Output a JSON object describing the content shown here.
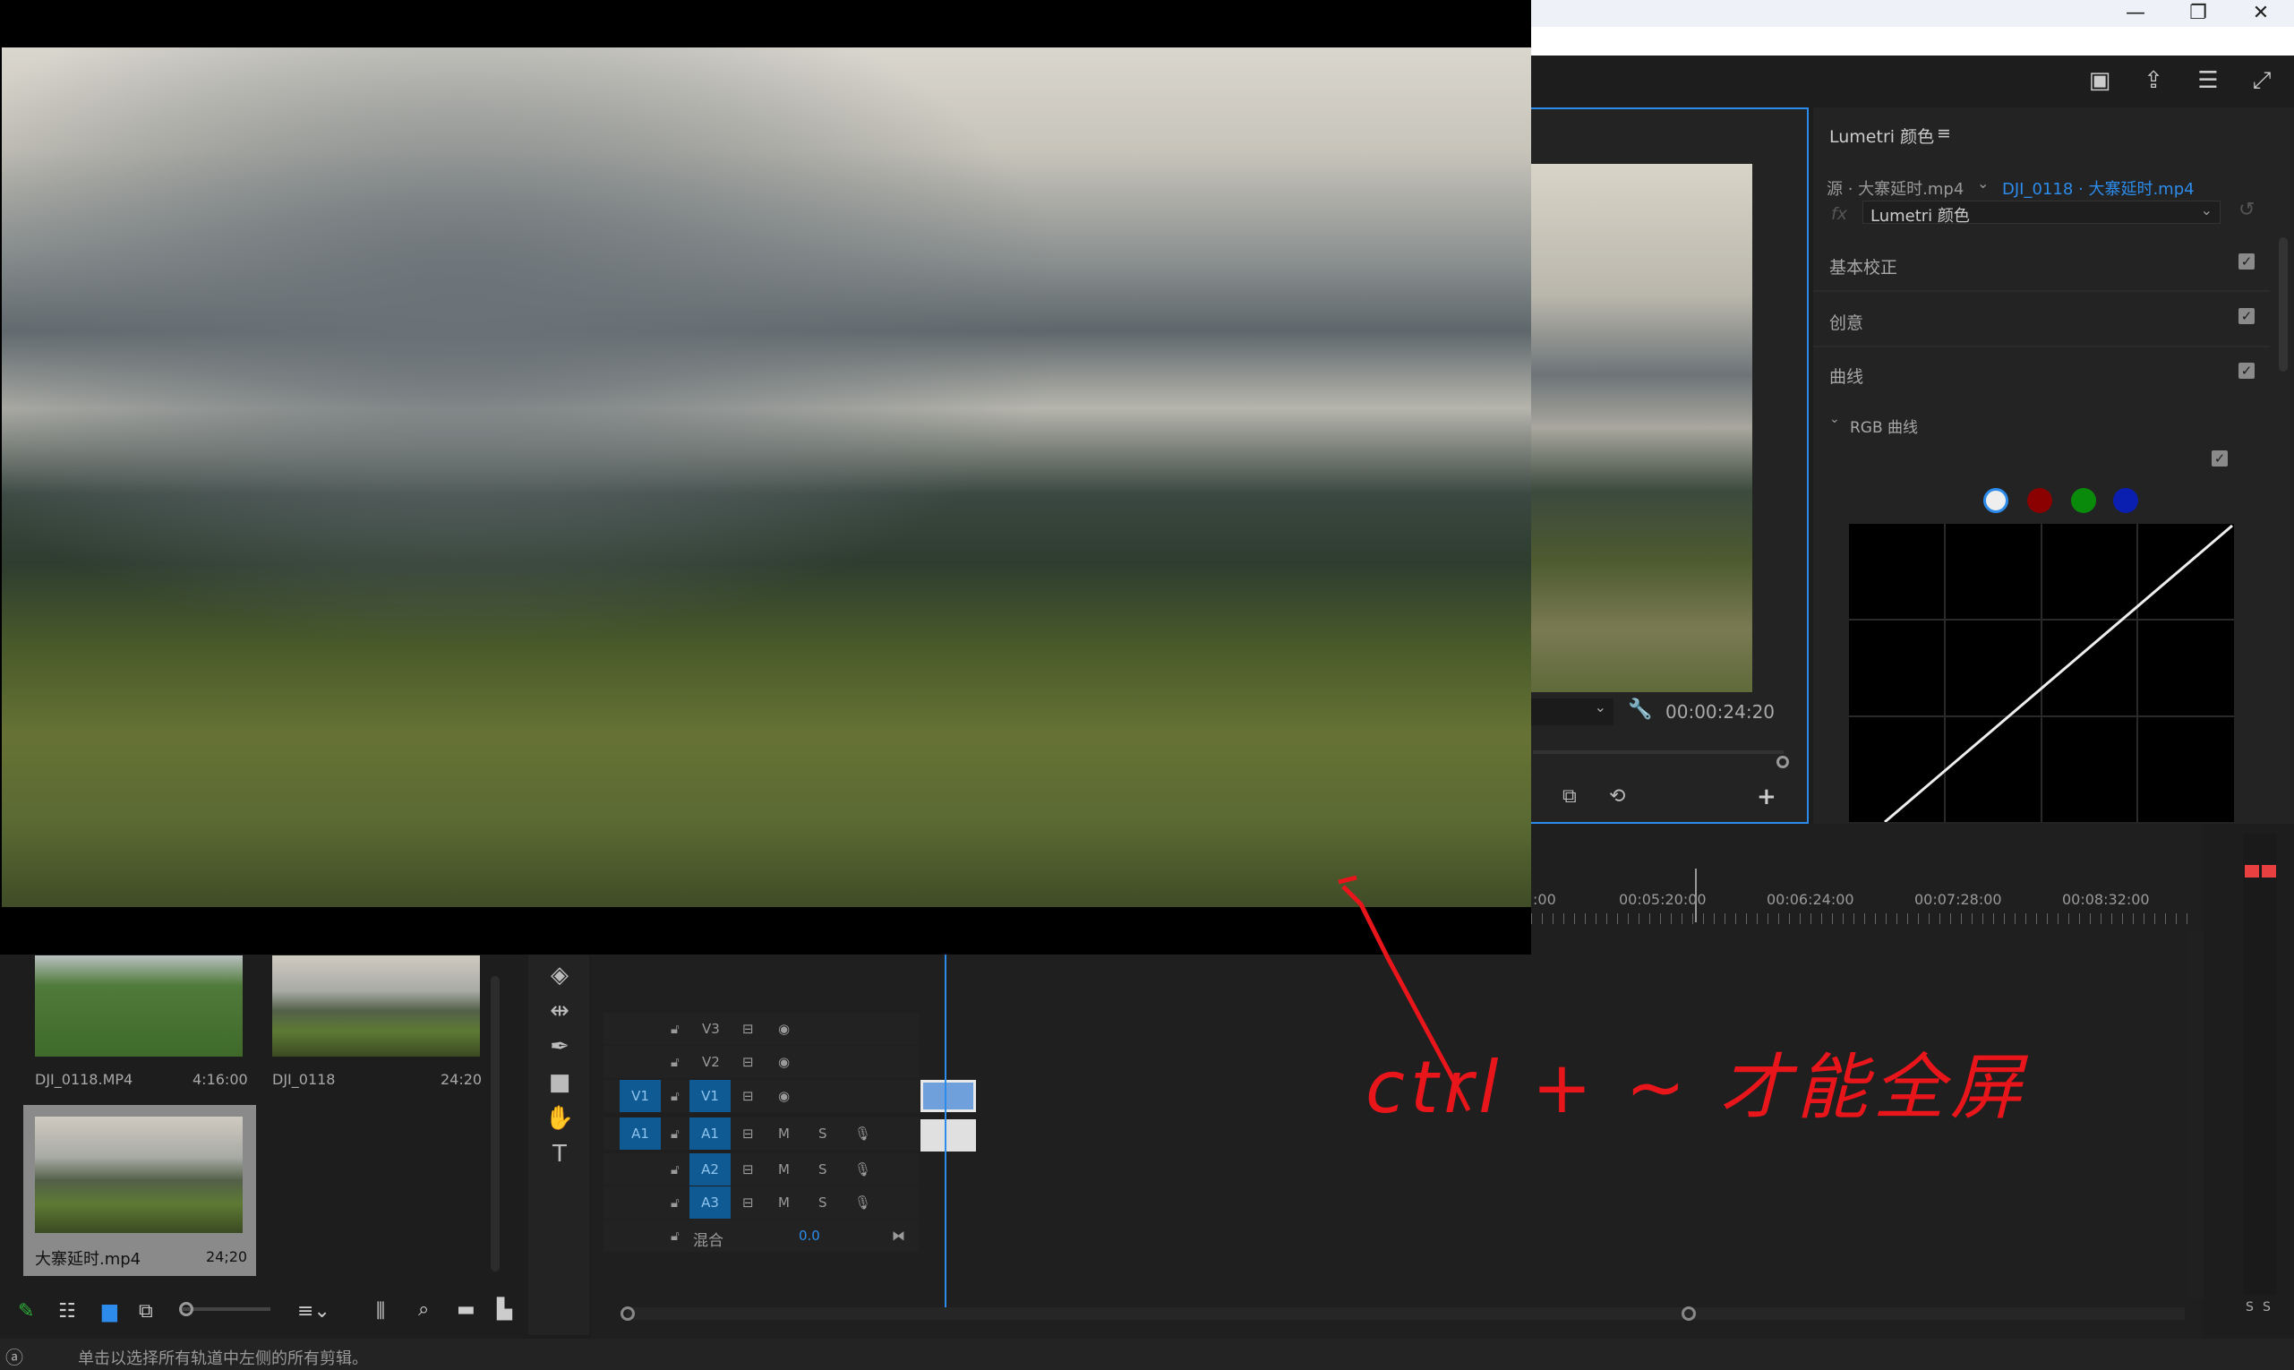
{
  "window": {
    "minimize": "—",
    "restore": "❐",
    "close": "✕"
  },
  "header_icons": [
    "workspaces-icon",
    "export-icon",
    "menu-icon",
    "fullscreen-icon"
  ],
  "program_monitor": {
    "timecode": "00:00:24:20"
  },
  "lumetri": {
    "title": "Lumetri 颜色",
    "menu": "≡",
    "source_label": "源 · 大寨延时.mp4",
    "sequence_label": "DJI_0118 · 大寨延时.mp4",
    "fx": "fx",
    "effect_select": "Lumetri 颜色",
    "sections": [
      {
        "label": "基本校正",
        "checked": true
      },
      {
        "label": "创意",
        "checked": true
      },
      {
        "label": "曲线",
        "checked": true
      }
    ],
    "rgb_curve_label": "RGB 曲线",
    "rgb_curve_checked": true,
    "channel_colors": [
      "#ffffff",
      "#8b0000",
      "#0a8a0a",
      "#0a1fb0"
    ]
  },
  "timeline": {
    "ruler": [
      ":00",
      "00:05:20:00",
      "00:06:24:00",
      "00:07:28:00",
      "00:08:32:00"
    ],
    "video_tracks": [
      {
        "label": "V3",
        "patch": ""
      },
      {
        "label": "V2",
        "patch": ""
      },
      {
        "label": "V1",
        "patch": "V1"
      }
    ],
    "audio_tracks": [
      {
        "label": "A1",
        "patch": "A1"
      },
      {
        "label": "A2",
        "patch": ""
      },
      {
        "label": "A3",
        "patch": ""
      }
    ],
    "mute": "M",
    "solo": "S",
    "mix_label": "混合",
    "mix_value": "0.0"
  },
  "project": {
    "items": [
      {
        "name": "DJI_0118.MP4",
        "duration": "4:16:00"
      },
      {
        "name": "DJI_0118",
        "duration": "24:20"
      },
      {
        "name": "大寨延时.mp4",
        "duration": "24;20",
        "selected": true
      }
    ]
  },
  "audio_meter": {
    "labels": [
      "S",
      "S"
    ],
    "clip_color": "#e84040"
  },
  "status_text": "单击以选择所有轨道中左侧的所有剪辑。",
  "annotation": "ctrl + ~ 才能全屏",
  "accent": "#2d8ceb"
}
